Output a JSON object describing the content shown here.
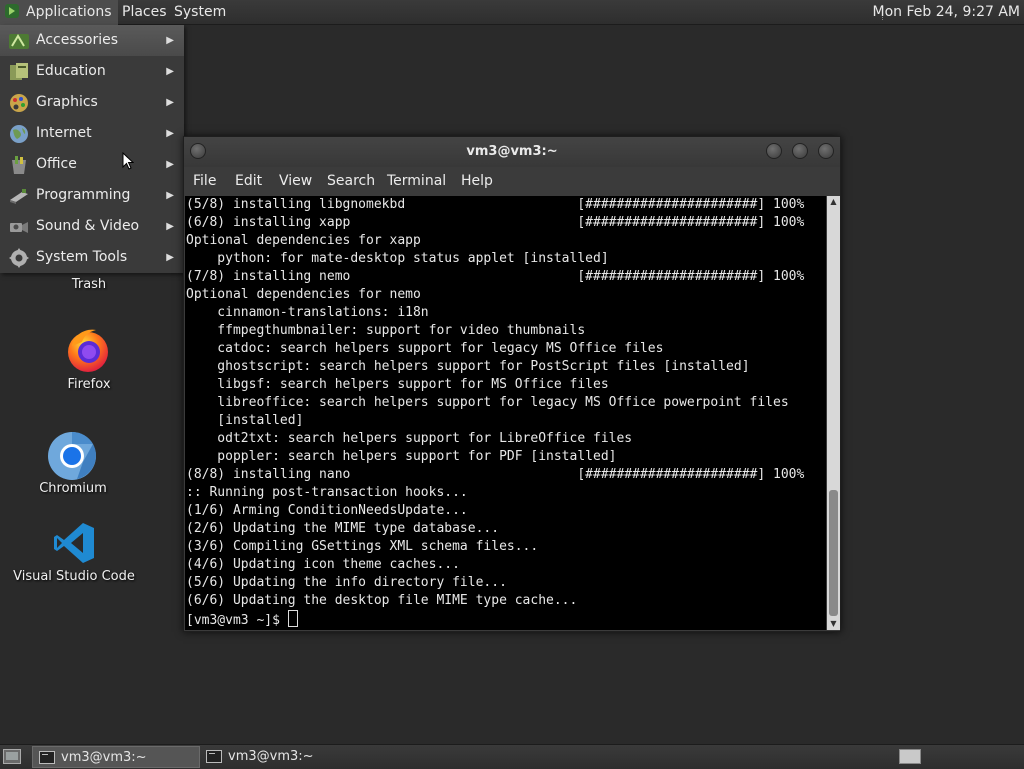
{
  "top_panel": {
    "applications": "Applications",
    "places": "Places",
    "system": "System",
    "clock": "Mon Feb 24,  9:27 AM"
  },
  "apps_menu": {
    "items": [
      {
        "label": "Accessories",
        "icon": "accessories-icon"
      },
      {
        "label": "Education",
        "icon": "education-icon"
      },
      {
        "label": "Graphics",
        "icon": "graphics-icon"
      },
      {
        "label": "Internet",
        "icon": "internet-icon"
      },
      {
        "label": "Office",
        "icon": "office-icon"
      },
      {
        "label": "Programming",
        "icon": "programming-icon"
      },
      {
        "label": "Sound & Video",
        "icon": "sound-video-icon"
      },
      {
        "label": "System Tools",
        "icon": "system-tools-icon"
      }
    ]
  },
  "desktop": {
    "trash": "Trash",
    "firefox": "Firefox",
    "chromium": "Chromium",
    "vscode": "Visual Studio Code"
  },
  "terminal": {
    "title": "vm3@vm3:~",
    "menu": [
      "File",
      "Edit",
      "View",
      "Search",
      "Terminal",
      "Help"
    ],
    "lines": [
      "(5/8) installing libgnomekbd                      [######################] 100%",
      "(6/8) installing xapp                             [######################] 100%",
      "Optional dependencies for xapp",
      "    python: for mate-desktop status applet [installed]",
      "(7/8) installing nemo                             [######################] 100%",
      "Optional dependencies for nemo",
      "    cinnamon-translations: i18n",
      "    ffmpegthumbnailer: support for video thumbnails",
      "    catdoc: search helpers support for legacy MS Office files",
      "    ghostscript: search helpers support for PostScript files [installed]",
      "    libgsf: search helpers support for MS Office files",
      "    libreoffice: search helpers support for legacy MS Office powerpoint files",
      "    [installed]",
      "    odt2txt: search helpers support for LibreOffice files",
      "    poppler: search helpers support for PDF [installed]",
      "(8/8) installing nano                             [######################] 100%",
      ":: Running post-transaction hooks...",
      "(1/6) Arming ConditionNeedsUpdate...",
      "(2/6) Updating the MIME type database...",
      "(3/6) Compiling GSettings XML schema files...",
      "(4/6) Updating icon theme caches...",
      "(5/6) Updating the info directory file...",
      "(6/6) Updating the desktop file MIME type cache..."
    ],
    "prompt": "[vm3@vm3 ~]$ "
  },
  "taskbar": {
    "tasks": [
      "vm3@vm3:~",
      "vm3@vm3:~"
    ]
  }
}
